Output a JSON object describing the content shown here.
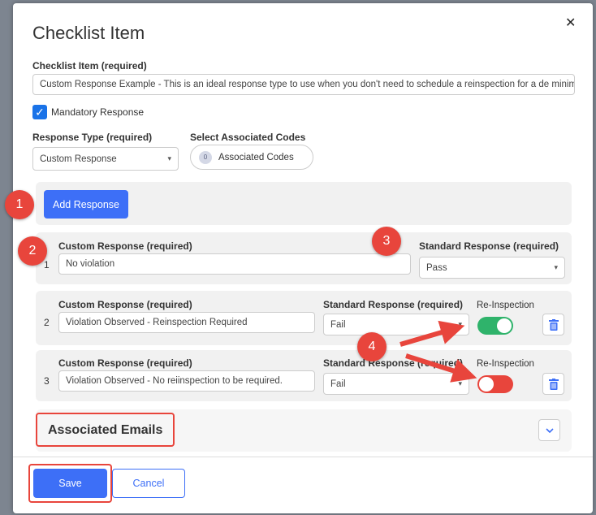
{
  "dialog": {
    "title": "Checklist Item",
    "close_glyph": "✕"
  },
  "checklist_item": {
    "label": "Checklist Item (required)",
    "value": "Custom Response Example - This is an ideal response type to use when you don't need to schedule a reinspection for a de minimus"
  },
  "mandatory": {
    "label": "Mandatory Response",
    "checked": true,
    "check_glyph": "✓"
  },
  "response_type": {
    "label": "Response Type (required)",
    "value": "Custom Response"
  },
  "associated_codes": {
    "label": "Select Associated Codes",
    "count": "0",
    "button_label": "Associated Codes"
  },
  "add_response_label": "Add Response",
  "responses": [
    {
      "number": "1",
      "custom_label": "Custom Response (required)",
      "custom_value": "No violation",
      "standard_label": "Standard Response (required)",
      "standard_value": "Pass"
    },
    {
      "number": "2",
      "custom_label": "Custom Response (required)",
      "custom_value": "Violation Observed - Reinspection Required",
      "standard_label": "Standard Response (required)",
      "standard_value": "Fail",
      "reinspection_label": "Re-Inspection",
      "reinspection_on": true
    },
    {
      "number": "3",
      "custom_label": "Custom Response (required)",
      "custom_value": "Violation Observed - No reiinspection to be required.",
      "standard_label": "Standard Response (required)",
      "standard_value": "Fail",
      "reinspection_label": "Re-Inspection",
      "reinspection_on": false
    }
  ],
  "associated_emails_label": "Associated Emails",
  "footer": {
    "save_label": "Save",
    "cancel_label": "Cancel"
  },
  "callouts": [
    "1",
    "2",
    "3",
    "4"
  ],
  "colors": {
    "primary": "#3d6ff7",
    "toggle_on": "#2fb36b",
    "toggle_off": "#e8453c",
    "callout": "#e8453c",
    "trash": "#3d6ff7"
  },
  "icons": {
    "caret": "▾",
    "chevron": "chevron-down-icon",
    "trash": "trash-icon"
  }
}
